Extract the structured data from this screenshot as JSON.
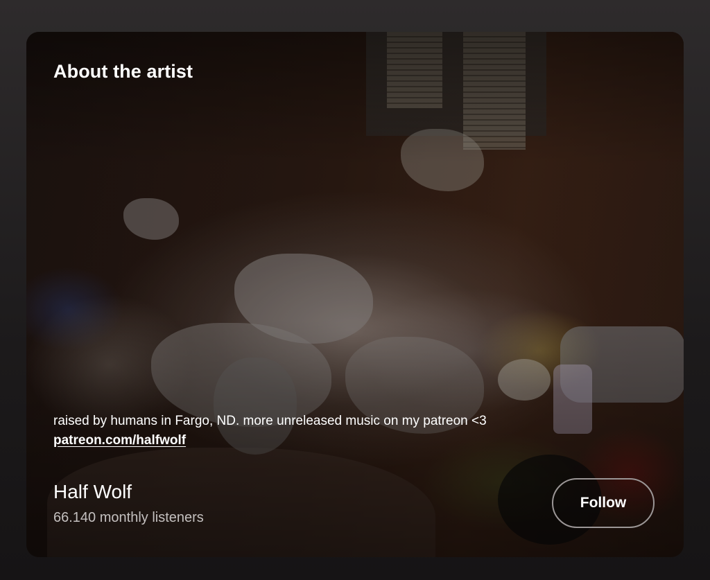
{
  "about": {
    "heading": "About the artist",
    "bio": "raised by humans in Fargo, ND. more unreleased music on my patreon <3",
    "link": "patreon.com/halfwolf"
  },
  "artist": {
    "name": "Half Wolf",
    "listeners": "66.140 monthly listeners"
  },
  "actions": {
    "follow_label": "Follow"
  },
  "colors": {
    "background": "#1c1a1b",
    "text": "#ffffff",
    "secondary_text": "#c4c0bf",
    "button_border": "#9b9696"
  }
}
